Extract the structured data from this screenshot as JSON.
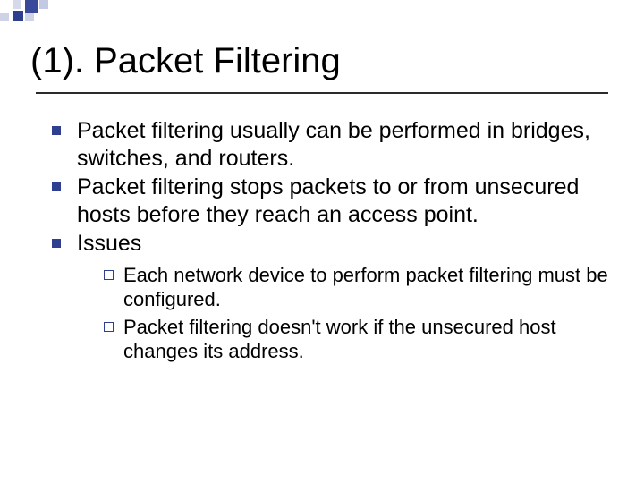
{
  "title": "(1). Packet Filtering",
  "bullets": [
    "Packet filtering usually can be performed in bridges, switches, and routers.",
    "Packet filtering stops packets to or from unsecured hosts before they reach an access point.",
    "Issues"
  ],
  "sub_bullets": [
    "Each network device to perform packet filtering must be configured.",
    "Packet filtering doesn't work if the unsecured host changes its address."
  ]
}
